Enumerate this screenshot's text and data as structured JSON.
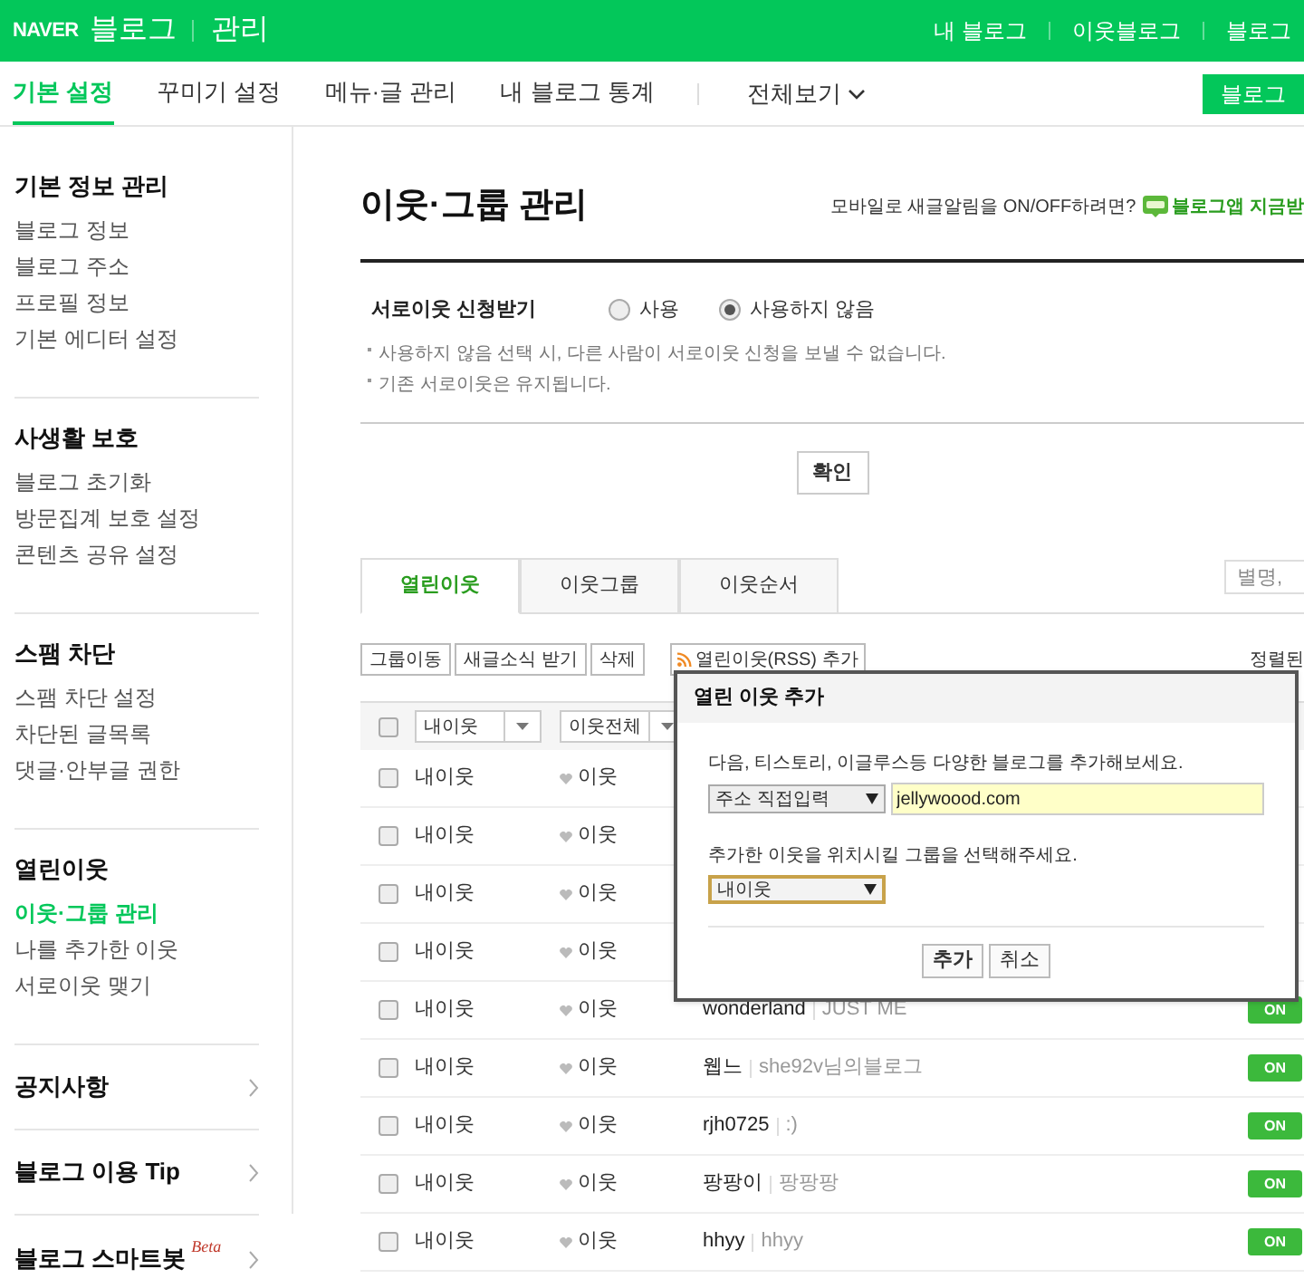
{
  "header": {
    "logo": "NAVER",
    "service": "블로그",
    "section": "관리",
    "links": [
      "내 블로그",
      "이웃블로그",
      "블로그"
    ]
  },
  "nav": {
    "tabs": [
      {
        "label": "기본 설정",
        "selected": true
      },
      {
        "label": "꾸미기 설정",
        "selected": false
      },
      {
        "label": "메뉴·글 관리",
        "selected": false
      },
      {
        "label": "내 블로그 통계",
        "selected": false
      }
    ],
    "more": "전체보기",
    "button": "블로그"
  },
  "sidebar": {
    "groups": [
      {
        "title": "기본 정보 관리",
        "items": [
          {
            "label": "블로그 정보",
            "selected": false
          },
          {
            "label": "블로그 주소",
            "selected": false
          },
          {
            "label": "프로필 정보",
            "selected": false
          },
          {
            "label": "기본 에디터 설정",
            "selected": false
          }
        ]
      },
      {
        "title": "사생활 보호",
        "items": [
          {
            "label": "블로그 초기화",
            "selected": false
          },
          {
            "label": "방문집계 보호 설정",
            "selected": false
          },
          {
            "label": "콘텐츠 공유 설정",
            "selected": false
          }
        ]
      },
      {
        "title": "스팸 차단",
        "items": [
          {
            "label": "스팸 차단 설정",
            "selected": false
          },
          {
            "label": "차단된 글목록",
            "selected": false
          },
          {
            "label": "댓글·안부글 권한",
            "selected": false
          }
        ]
      },
      {
        "title": "열린이웃",
        "items": [
          {
            "label": "이웃·그룹 관리",
            "selected": true
          },
          {
            "label": "나를 추가한 이웃",
            "selected": false
          },
          {
            "label": "서로이웃 맺기",
            "selected": false
          }
        ]
      }
    ],
    "links": [
      {
        "label": "공지사항"
      },
      {
        "label": "블로그 이용 Tip"
      },
      {
        "label": "블로그 스마트봇",
        "badge": "Beta"
      }
    ]
  },
  "main": {
    "title": "이웃·그룹 관리",
    "promo": "모바일로 새글알림을 ON/OFF하려면?",
    "promo_link": "블로그앱 지금받",
    "setting": {
      "label": "서로이웃 신청받기",
      "options": [
        {
          "label": "사용",
          "selected": false
        },
        {
          "label": "사용하지 않음",
          "selected": true
        }
      ],
      "notes": [
        "사용하지 않음 선택 시, 다른 사람이 서로이웃 신청을 보낼 수 없습니다.",
        "기존 서로이웃은 유지됩니다."
      ],
      "confirm": "확인"
    },
    "tabs": [
      {
        "label": "열린이웃",
        "selected": true
      },
      {
        "label": "이웃그룹",
        "selected": false
      },
      {
        "label": "이웃순서",
        "selected": false
      }
    ],
    "search_placeholder": "별명,",
    "toolbar": [
      "그룹이동",
      "새글소식 받기",
      "삭제"
    ],
    "rss_button": "열린이웃(RSS) 추가",
    "sort_label": "정렬된",
    "table_header": {
      "checked": false,
      "group_select": "내이웃",
      "filter_select": "이웃전체"
    },
    "rows": [
      {
        "checked": false,
        "group": "내이웃",
        "relation": "이웃"
      },
      {
        "checked": false,
        "group": "내이웃",
        "relation": "이웃"
      },
      {
        "checked": false,
        "group": "내이웃",
        "relation": "이웃"
      },
      {
        "checked": false,
        "group": "내이웃",
        "relation": "이웃"
      },
      {
        "checked": false,
        "group": "내이웃",
        "relation": "이웃",
        "name": "wonderland",
        "description": "JUST ME",
        "notify": "ON"
      },
      {
        "checked": false,
        "group": "내이웃",
        "relation": "이웃",
        "name": "웹느",
        "description": "she92v님의블로그",
        "notify": "ON"
      },
      {
        "checked": false,
        "group": "내이웃",
        "relation": "이웃",
        "name": "rjh0725",
        "description": ":)",
        "notify": "ON"
      },
      {
        "checked": false,
        "group": "내이웃",
        "relation": "이웃",
        "name": "팡팡이",
        "description": "팡팡팡",
        "notify": "ON"
      },
      {
        "checked": false,
        "group": "내이웃",
        "relation": "이웃",
        "name": "hhyy",
        "description": "hhyy",
        "notify": "ON"
      }
    ]
  },
  "dialog": {
    "title": "열린 이웃 추가",
    "prompt": "다음, 티스토리, 이글루스등 다양한 블로그를 추가해보세요.",
    "source_select": "주소 직접입력",
    "url": "jellywoood.com",
    "group_prompt": "추가한 이웃을 위치시킬 그룹을 선택해주세요.",
    "group_select": "내이웃",
    "buttons": [
      "추가",
      "취소"
    ]
  }
}
